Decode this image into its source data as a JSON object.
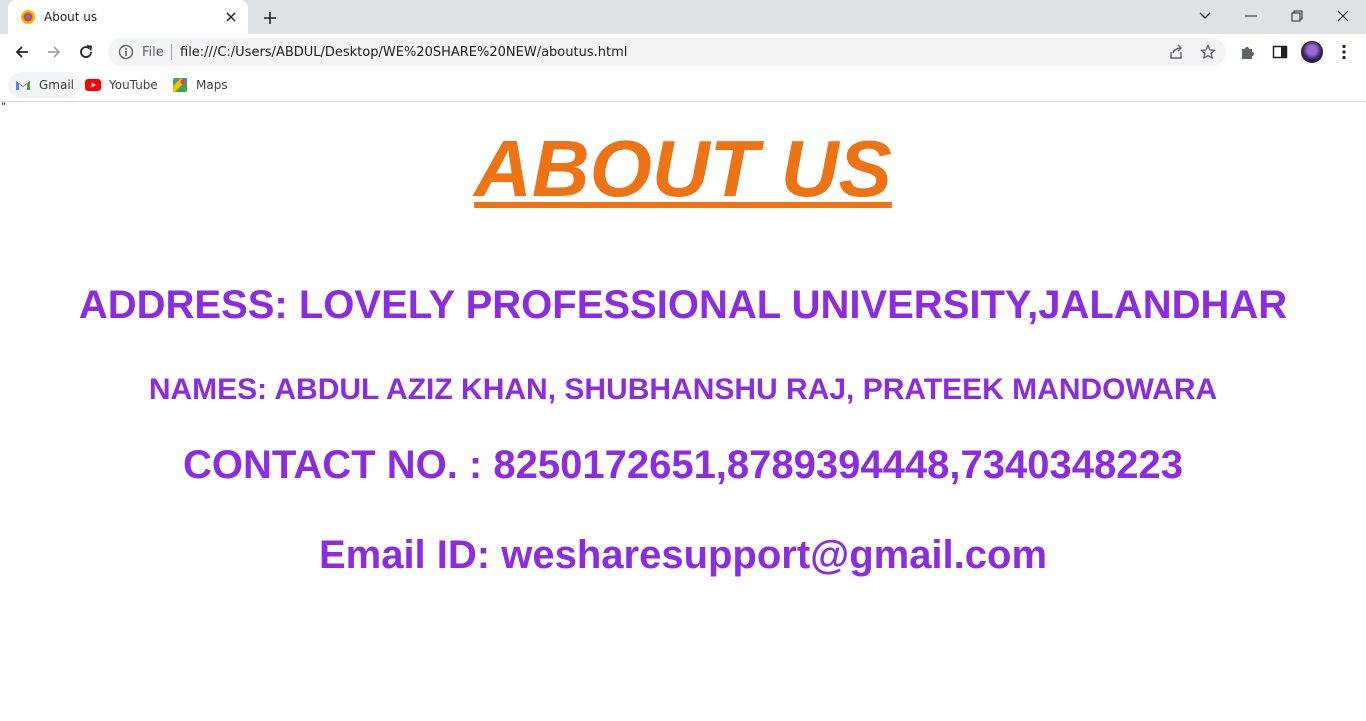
{
  "browser": {
    "tab_title": "About us",
    "url_scheme": "File",
    "url": "file:///C:/Users/ABDUL/Desktop/WE%20SHARE%20NEW/aboutus.html",
    "bookmarks": [
      {
        "label": "Gmail",
        "icon": "gmail-icon"
      },
      {
        "label": "YouTube",
        "icon": "youtube-icon"
      },
      {
        "label": "Maps",
        "icon": "maps-icon"
      }
    ]
  },
  "page": {
    "stray_char": "\"",
    "title": "ABOUT US",
    "address": "ADDRESS: LOVELY PROFESSIONAL UNIVERSITY,JALANDHAR",
    "names": "NAMES: ABDUL AZIZ KHAN, SHUBHANSHU RAJ, PRATEEK MANDOWARA",
    "contact": "CONTACT NO. : 8250172651,8789394448,7340348223",
    "email": "Email ID: wesharesupport@gmail.com"
  },
  "colors": {
    "title": "#ed7315",
    "info_text": "#8b2be2",
    "tabstrip_bg": "#dee1e6"
  }
}
